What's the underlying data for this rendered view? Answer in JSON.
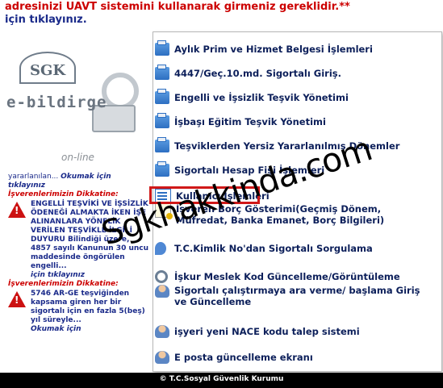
{
  "header": {
    "notice_text": "adresinizi UAVT sistemini kullanarak girmeniz gereklidir.",
    "notice_stars": "**",
    "click_here": "için tıklayınız."
  },
  "brand": {
    "logo_text": "SGK",
    "product_name": "e-bildirge",
    "status": "on-line"
  },
  "left_panel": {
    "intro_line1": "yararlanılan...",
    "intro_more": "Okumak için",
    "intro_line2": "tıklayınız",
    "notices": [
      {
        "title": "İşverenlerimizin Dikkatine:",
        "body": "ENGELLİ TEŞVİKİ VE İŞSİZLİK ÖDENEĞİ ALMAKTA İKEN İŞE ALINANLARA YÖNELİK VERİLEN TEŞVİKLE İLGİLİ DUYURU Bilindiği üzere, 4857 sayılı Kanunun 30 uncu maddesinde öngörülen engelli...",
        "more": "için tıklayınız"
      },
      {
        "title": "İşverenlerimizin Dikkatine:",
        "body": "5746 AR-GE teşviğinden kapsama giren her bir sigortalı için en fazla 5(beş) yıl süreyle...",
        "more": "Okumak için"
      }
    ]
  },
  "menu": {
    "items": [
      {
        "label": "Aylık Prim ve Hizmet Belgesi İşlemleri",
        "icon": "folder-icon"
      },
      {
        "label": "4447/Geç.10.md. Sigortalı Giriş.",
        "icon": "folder-icon"
      },
      {
        "label": "Engelli ve İşsizlik Teşvik Yönetimi",
        "icon": "folder-icon"
      },
      {
        "label": "İşbaşı Eğitim Teşvik Yönetimi",
        "icon": "folder-icon"
      },
      {
        "label": "Teşviklerden Yersiz Yararlanılmış Dönemler",
        "icon": "folder-icon"
      },
      {
        "label": "Sigortalı Hesap Fişi İşlemleri",
        "icon": "folder-icon"
      },
      {
        "label": "Kullanıcı İşlemleri",
        "icon": "form-icon"
      },
      {
        "label": "İşveren Borç Gösterimi(Geçmiş Dönem, Müfredat, Banka Emanet, Borç Bilgileri)",
        "icon": "note-icon"
      },
      {
        "label": "T.C.Kimlik No'dan Sigortalı Sorgulama",
        "icon": "pin-icon"
      },
      {
        "label": "İşkur Meslek Kod Güncelleme/Görüntüleme",
        "icon": "gear-icon"
      },
      {
        "label": "Sigortalı çalıştırmaya ara verme/ başlama Giriş ve Güncelleme",
        "icon": "user-icon"
      },
      {
        "label": "işyeri yeni NACE kodu talep sistemi",
        "icon": "user-icon"
      },
      {
        "label": "E posta güncelleme ekranı",
        "icon": "user-icon"
      }
    ]
  },
  "watermark": "Sgkhakkinda.com",
  "footer": {
    "copyright": "© T.C.Sosyal Güvenlik Kurumu"
  },
  "colors": {
    "notice_red": "#cc0000",
    "link_blue": "#1a2a8a",
    "menu_text": "#0c1f5a",
    "highlight_red": "#d01818",
    "footer_bg": "#000000"
  }
}
